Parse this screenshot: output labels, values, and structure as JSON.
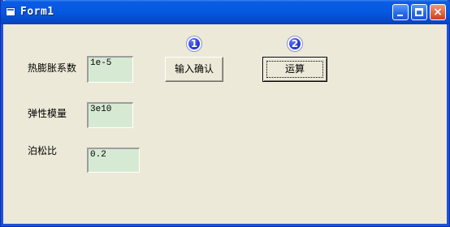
{
  "window": {
    "title": "Form1"
  },
  "labels": {
    "thermal_expansion": "热膨胀系数",
    "elastic_modulus": "弹性模量",
    "poisson_ratio": "泊松比"
  },
  "inputs": {
    "thermal_expansion_value": "1e-5",
    "elastic_modulus_value": "3e10",
    "poisson_ratio_value": "0.2"
  },
  "buttons": {
    "confirm_label": "输入确认",
    "calculate_label": "运算"
  },
  "badges": {
    "confirm_step": "1",
    "calculate_step": "2"
  },
  "icons": {
    "window_icon": "application-window-icon",
    "minimize": "minimize-icon",
    "maximize": "maximize-icon",
    "close": "close-icon"
  },
  "colors": {
    "titlebar": "#0558e0",
    "face": "#ece9d8",
    "input_background": "#d6ead3",
    "badge": "#2636d9",
    "close": "#e16440"
  }
}
